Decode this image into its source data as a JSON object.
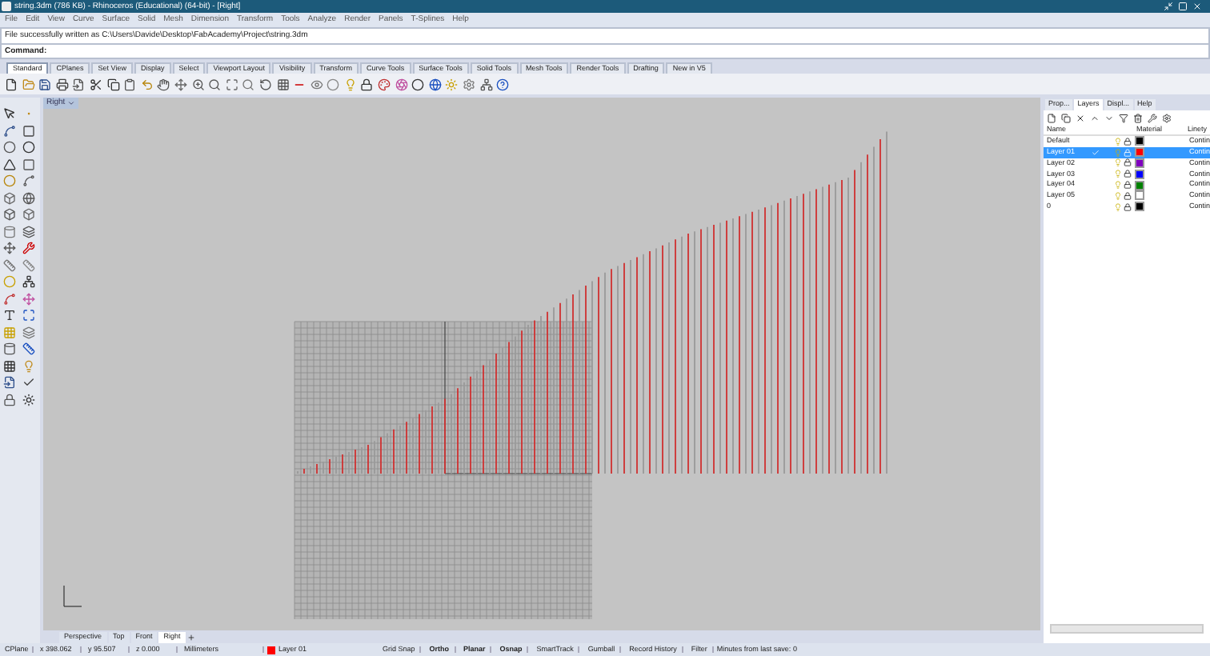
{
  "window": {
    "title": "string.3dm (786 KB) - Rhinoceros (Educational) (64-bit) - [Right]"
  },
  "menu": [
    "File",
    "Edit",
    "View",
    "Curve",
    "Surface",
    "Solid",
    "Mesh",
    "Dimension",
    "Transform",
    "Tools",
    "Analyze",
    "Render",
    "Panels",
    "T-Splines",
    "Help"
  ],
  "command_history": "File successfully written as C:\\Users\\Davide\\Desktop\\FabAcademy\\Project\\string.3dm",
  "command_prompt": "Command:",
  "toolbar_tabs": [
    {
      "label": "Standard",
      "selected": true
    },
    {
      "label": "CPlanes",
      "selected": false
    },
    {
      "label": "Set View",
      "selected": false
    },
    {
      "label": "Display",
      "selected": false
    },
    {
      "label": "Select",
      "selected": false
    },
    {
      "label": "Viewport Layout",
      "selected": false
    },
    {
      "label": "Visibility",
      "selected": false
    },
    {
      "label": "Transform",
      "selected": false
    },
    {
      "label": "Curve Tools",
      "selected": false
    },
    {
      "label": "Surface Tools",
      "selected": false
    },
    {
      "label": "Solid Tools",
      "selected": false
    },
    {
      "label": "Mesh Tools",
      "selected": false
    },
    {
      "label": "Render Tools",
      "selected": false
    },
    {
      "label": "Drafting",
      "selected": false
    },
    {
      "label": "New in V5",
      "selected": false
    }
  ],
  "viewport": {
    "label": "Right"
  },
  "viewport_tabs": [
    {
      "label": "Perspective",
      "selected": false
    },
    {
      "label": "Top",
      "selected": false
    },
    {
      "label": "Front",
      "selected": false
    },
    {
      "label": "Right",
      "selected": true
    }
  ],
  "panel": {
    "tabs": [
      {
        "label": "Prop...",
        "selected": false
      },
      {
        "label": "Layers",
        "selected": true
      },
      {
        "label": "Displ...",
        "selected": false
      },
      {
        "label": "Help",
        "selected": false
      }
    ],
    "columns": [
      "Name",
      "Material",
      "Linety"
    ],
    "layers": [
      {
        "name": "Default",
        "selected": false,
        "current": false,
        "color": "#000000",
        "linetype": "Contin"
      },
      {
        "name": "Layer 01",
        "selected": true,
        "current": true,
        "color": "#ff0000",
        "linetype": "Contin"
      },
      {
        "name": "Layer 02",
        "selected": false,
        "current": false,
        "color": "#7f00bf",
        "linetype": "Contin"
      },
      {
        "name": "Layer 03",
        "selected": false,
        "current": false,
        "color": "#0000ff",
        "linetype": "Contin"
      },
      {
        "name": "Layer 04",
        "selected": false,
        "current": false,
        "color": "#008000",
        "linetype": "Contin"
      },
      {
        "name": "Layer 05",
        "selected": false,
        "current": false,
        "color": "#ffffff",
        "linetype": "Contin"
      },
      {
        "name": "0",
        "selected": false,
        "current": false,
        "color": "#000000",
        "linetype": "Contin"
      }
    ]
  },
  "status_bar": {
    "cplane": "CPlane",
    "x": "x 398.062",
    "y": "y 95.507",
    "z": "z 0.000",
    "units": "Millimeters",
    "layer": {
      "name": "Layer 01",
      "color": "#ff0000"
    },
    "toggles": [
      {
        "label": "Grid Snap",
        "on": false
      },
      {
        "label": "Ortho",
        "on": true
      },
      {
        "label": "Planar",
        "on": true
      },
      {
        "label": "Osnap",
        "on": true
      },
      {
        "label": "SmartTrack",
        "on": false
      },
      {
        "label": "Gumball",
        "on": false
      },
      {
        "label": "Record History",
        "on": false
      },
      {
        "label": "Filter",
        "on": false
      }
    ],
    "message": "Minutes from last save: 0"
  }
}
